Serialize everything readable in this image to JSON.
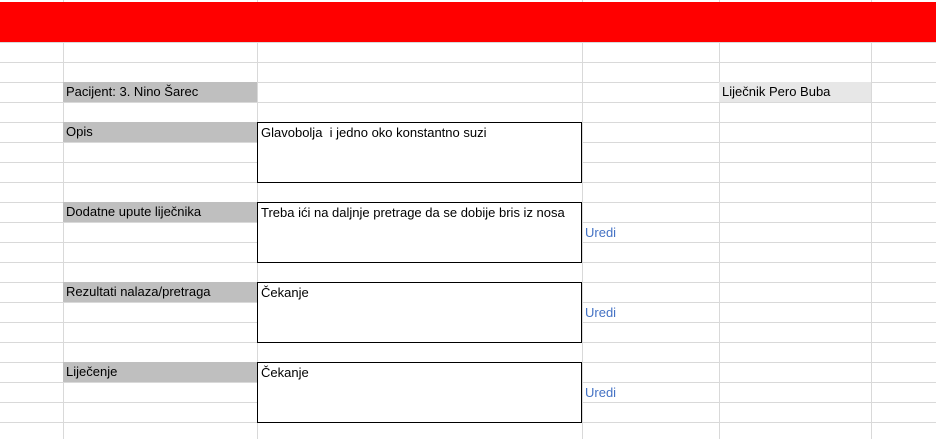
{
  "patient": {
    "label": "Pacijent: 3. Nino Šarec"
  },
  "doctor": {
    "label": "Liječnik Pero Buba"
  },
  "sections": [
    {
      "key": "opis",
      "label": "Opis",
      "content": "Glavobolja  i jedno oko konstantno suzi",
      "edit_link": null
    },
    {
      "key": "dodatne_upute",
      "label": "Dodatne upute liječnika",
      "content": "Treba ići na daljnje pretrage da se dobije bris iz nosa",
      "edit_link": "Uredi"
    },
    {
      "key": "rezultati",
      "label": "Rezultati nalaza/pretraga",
      "content": "Čekanje",
      "edit_link": "Uredi"
    },
    {
      "key": "lijecenje",
      "label": "Liječenje",
      "content": "Čekanje",
      "edit_link": "Uredi"
    }
  ],
  "colors": {
    "header_bar": "#ff0000",
    "label_bg": "#bfbfbf",
    "doctor_bg": "#e7e7e7",
    "link": "#4472c4"
  }
}
